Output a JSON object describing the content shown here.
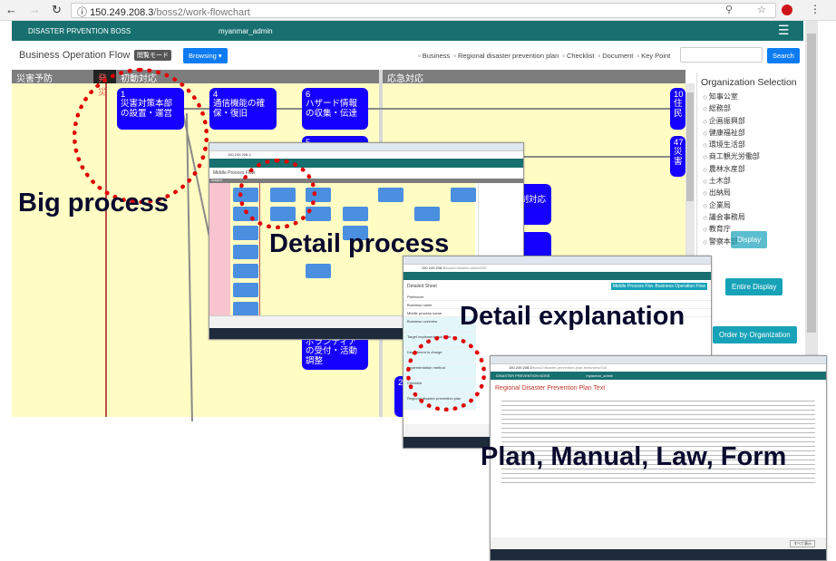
{
  "browser": {
    "url_host": "150.249.208.3",
    "url_path": "/boss2/work-flowchart"
  },
  "navbar": {
    "brand": "DISASTER PRVENTION BOSS",
    "user": "myanmar_admin"
  },
  "toolbar": {
    "title": "Business Operation Flow",
    "mode_badge": "閲覧モード",
    "browsing_button": "Browsing ▾",
    "filters": [
      "Business",
      "Regional disaster prevention plan",
      "Checklist",
      "Document",
      "Key Point"
    ],
    "search_placeholder": "",
    "search_button": "Search"
  },
  "columns": [
    "災害予防",
    "発災",
    "初動対応",
    "応急対応"
  ],
  "processes": [
    {
      "num": "1",
      "text": "災害対策本部の設置・運営"
    },
    {
      "num": "4",
      "text": "通信機能の確保・復旧"
    },
    {
      "num": "6",
      "text": "ハザード情報の収集・伝達"
    },
    {
      "num": "5",
      "text": ""
    },
    {
      "num": "10",
      "text": "住民"
    },
    {
      "num": "47",
      "text": "災害"
    },
    {
      "num": "",
      "text": "規制対応"
    },
    {
      "num": "",
      "text": "去"
    },
    {
      "num": "",
      "text": "ボランティアの受付・活動調整"
    },
    {
      "num": "",
      "text": "2"
    }
  ],
  "organization": {
    "title": "Organization Selection",
    "items": [
      "知事公室",
      "総務部",
      "企画振興部",
      "健康福祉部",
      "環境生活部",
      "商工観光労働部",
      "農林水産部",
      "土木部",
      "出納局",
      "企業局",
      "議会事務局",
      "教育庁",
      "警察本部"
    ],
    "display_button": "Display",
    "entire_button": "Entire Display",
    "order_button": "Order by Organization"
  },
  "detail_process": {
    "title": "Middle Process Flow",
    "subject": "Subject",
    "url_host": "150.249.208.3"
  },
  "detail_sheet": {
    "title": "Detailed Sheet",
    "url_host": "150.249.208.3",
    "url_path": "/boss2/detailed-sheet/240",
    "fields": [
      "Prefecture",
      "Business name",
      "Middle process name",
      "Business overview",
      "Target implementation date",
      "Department in charge",
      "Implementation method",
      "Checklist",
      "Regional disaster prevention plan"
    ],
    "buttons": [
      "Middle Process Flow",
      "Business Operation Flow"
    ]
  },
  "plan_text": {
    "title": "Regional Disaster Prevention Plan Text",
    "url_host": "150.249.208.3",
    "url_path": "/boss2/disaster-prevention-plan-texts/view/140",
    "brand": "DISASTER PREVENTION BOSS",
    "user": "myanmar_admin",
    "show_all": "すべて表示"
  },
  "labels": {
    "big": "Big process",
    "detail": "Detail process",
    "explanation": "Detail explanation",
    "plan": "Plan, Manual, Law, Form"
  },
  "colors": {
    "nav": "#17706f",
    "process": "#1500ff",
    "highlight": "#e00000",
    "canvas": "#fffdc4"
  }
}
